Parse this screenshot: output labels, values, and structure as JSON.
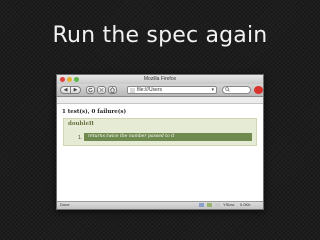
{
  "slide": {
    "title": "Run the spec again"
  },
  "window": {
    "title": "Mozilla Firefox",
    "toolbar": {
      "back_glyph": "◀",
      "forward_glyph": "▶",
      "url_value": "file:///Users",
      "url_arrow_glyph": "▾"
    },
    "status": {
      "text": "Done",
      "yslow": "YSlow",
      "size": "0.0Kb"
    }
  },
  "page": {
    "summary": "1 test(s), 0 failure(s)",
    "spec": {
      "name": "doubleIt",
      "number": "1.",
      "description": "returns twice the number passed to it"
    }
  },
  "colors": {
    "pass_row": "#6f8a4e",
    "spec_box": "#e6ebd6",
    "spec_name": "#6a7040"
  }
}
